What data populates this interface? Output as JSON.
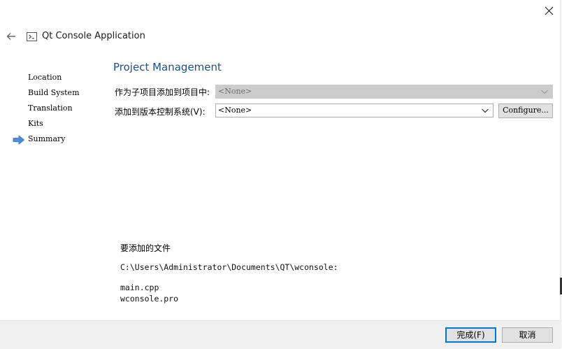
{
  "window": {
    "title": "Qt Console Application",
    "close_icon": "close-icon",
    "back_icon": "back-arrow-icon"
  },
  "sidebar": {
    "steps": [
      {
        "label": "Location"
      },
      {
        "label": "Build System"
      },
      {
        "label": "Translation"
      },
      {
        "label": "Kits"
      },
      {
        "label": "Summary",
        "current": true
      }
    ]
  },
  "page": {
    "heading": "Project Management",
    "subproject": {
      "label": "作为子项目添加到项目中:",
      "value": "<None>",
      "enabled": false
    },
    "vcs": {
      "label": "添加到版本控制系统(V):",
      "value": "<None>",
      "configure_label": "Configure..."
    },
    "files": {
      "title": "要添加的文件",
      "directory": "C:\\Users\\Administrator\\Documents\\QT\\wconsole:",
      "list": [
        "main.cpp",
        "wconsole.pro"
      ]
    }
  },
  "footer": {
    "finish_label": "完成(F)",
    "cancel_label": "取消"
  },
  "colors": {
    "heading": "#1e4e8c",
    "accent": "#0078d7",
    "current_step_arrow": "#4a90e2"
  }
}
